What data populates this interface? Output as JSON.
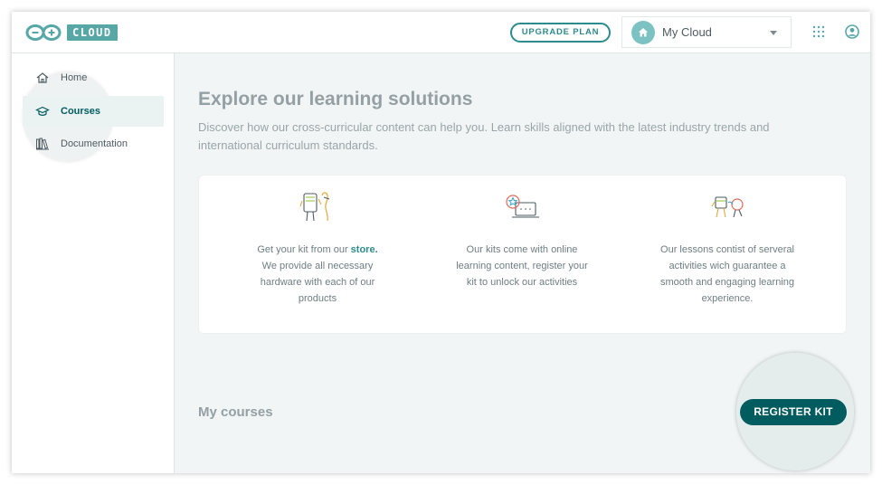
{
  "header": {
    "logo_badge": "CLOUD",
    "upgrade_label": "UPGRADE PLAN",
    "cloud_selector_label": "My Cloud",
    "icons": [
      "arduino-logo-icon",
      "home-icon",
      "chevron-down-icon",
      "apps-grid-icon",
      "user-account-icon"
    ]
  },
  "sidebar": {
    "items": [
      {
        "label": "Home",
        "icon": "home-icon",
        "active": false
      },
      {
        "label": "Courses",
        "icon": "graduation-cap-icon",
        "active": true
      },
      {
        "label": "Documentation",
        "icon": "books-icon",
        "active": false
      }
    ]
  },
  "main": {
    "title": "Explore our learning solutions",
    "subtitle": "Discover how our cross-curricular content can help you. Learn skills aligned with the latest industry trends and international curriculum standards.",
    "features": [
      {
        "icon": "kit-illustration-icon",
        "text_before": "Get your kit from our ",
        "link": "store.",
        "text_after": " We provide all necessary hardware with each of our products"
      },
      {
        "icon": "laptop-star-illustration-icon",
        "text": "Our kits come with online learning content, register your kit to unlock our activities"
      },
      {
        "icon": "characters-illustration-icon",
        "text": "Our lessons contist of serveral activities wich guarantee a smooth and engaging learning experience."
      }
    ],
    "my_courses_label": "My courses",
    "register_kit_label": "REGISTER KIT"
  },
  "colors": {
    "accent": "#005c5f",
    "teal": "#2e8b8b",
    "brand": "#58a7a7",
    "background": "#f1f5f5"
  }
}
